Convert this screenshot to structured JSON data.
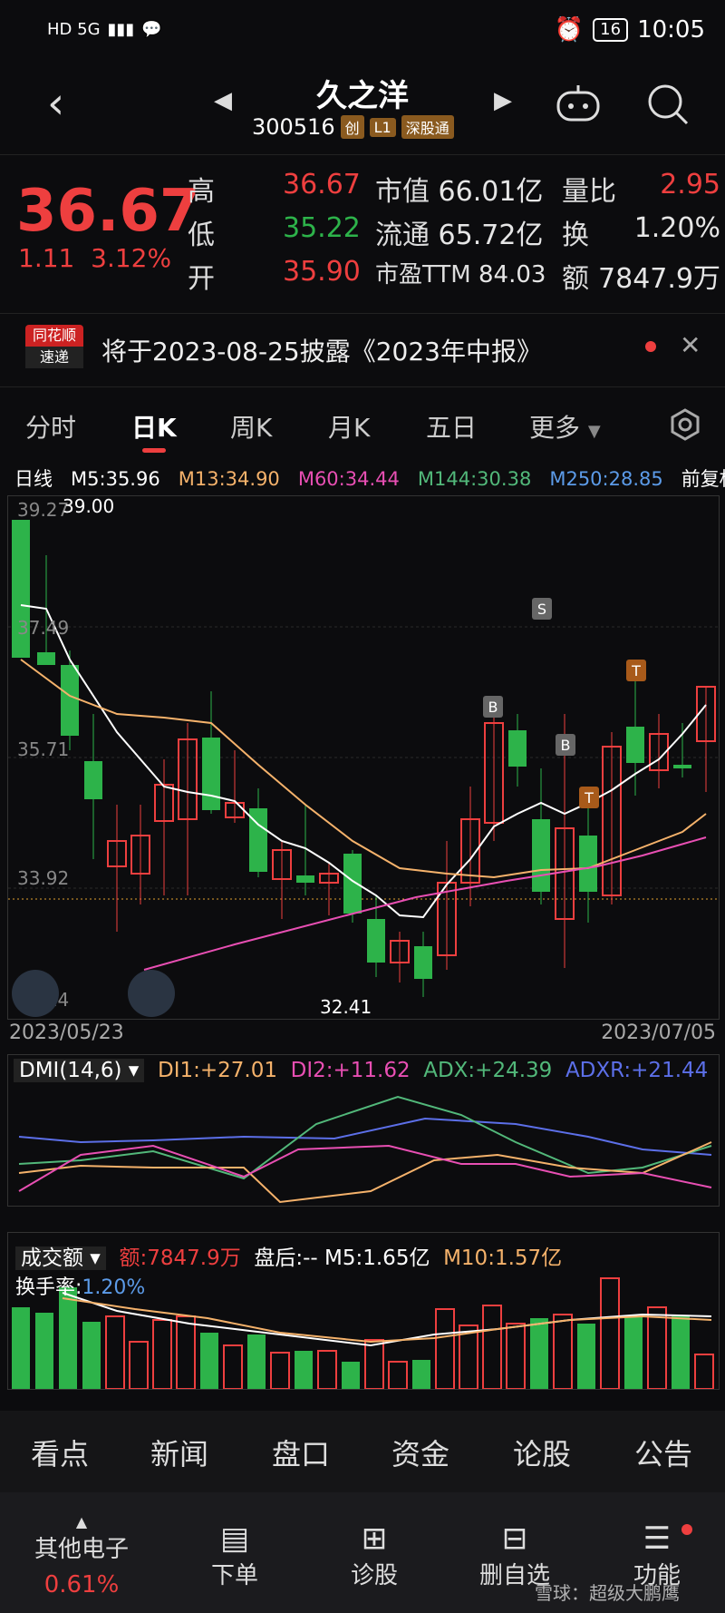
{
  "status": {
    "left": "HD 5G",
    "time": "10:05",
    "battery": "16"
  },
  "header": {
    "title": "久之洋",
    "code": "300516",
    "tags": [
      "创",
      "L1",
      "深股通"
    ]
  },
  "quote": {
    "price": "36.67",
    "change": "1.11",
    "change_pct": "3.12%",
    "high_label": "高",
    "high": "36.67",
    "low_label": "低",
    "low": "35.22",
    "open_label": "开",
    "open": "35.90",
    "mcap_label": "市值",
    "mcap": "66.01亿",
    "float_label": "流通",
    "float": "65.72亿",
    "pe_label": "市盈TTM",
    "pe": "84.03",
    "vr_label": "量比",
    "vr": "2.95",
    "turn_label": "换",
    "turn": "1.20%",
    "amt_label": "额",
    "amt": "7847.9万"
  },
  "notice": {
    "badge_top": "同花顺",
    "badge_bottom": "速递",
    "text": "将于2023-08-25披露《2023年中报》"
  },
  "tabs": [
    "分时",
    "日K",
    "周K",
    "月K",
    "五日",
    "更多"
  ],
  "ma": {
    "kind": "日线",
    "m5": "M5:35.96",
    "m13": "M13:34.90",
    "m60": "M60:34.44",
    "m144": "M144:30.38",
    "m250": "M250:28.85",
    "adjust": "前复权"
  },
  "kline": {
    "y_labels": [
      "39.27",
      "37.49",
      "35.71",
      "33.92",
      "32.14"
    ],
    "high_note": "39.00",
    "low_note": "32.41",
    "date_start": "2023/05/23",
    "date_end": "2023/07/05",
    "markers": [
      "B",
      "S",
      "B",
      "T",
      "T"
    ]
  },
  "dmi": {
    "name": "DMI(14,6)",
    "di1": "DI1:+27.01",
    "di2": "DI2:+11.62",
    "adx": "ADX:+24.39",
    "adxr": "ADXR:+21.44"
  },
  "volume": {
    "name": "成交额",
    "amt": "额:7847.9万",
    "after": "盘后:-- ",
    "m5": "M5:1.65亿",
    "m10": "M10:1.57亿",
    "turnover_label": "换手率:",
    "turnover": "1.20%"
  },
  "bottom_tabs": [
    "看点",
    "新闻",
    "盘口",
    "资金",
    "论股",
    "公告"
  ],
  "nav": {
    "sector": "其他电子",
    "sector_pct": "0.61%",
    "order": "下单",
    "diag": "诊股",
    "remove": "删自选",
    "func": "功能",
    "watermark": "雪球：超级大鹏鹰"
  },
  "colors": {
    "up": "#ee3f3f",
    "down": "#2db34a",
    "m5": "#ffffff",
    "m13": "#f5b26b",
    "m60": "#e84fb3",
    "m144": "#52b87a",
    "m250": "#5c9be8"
  }
}
